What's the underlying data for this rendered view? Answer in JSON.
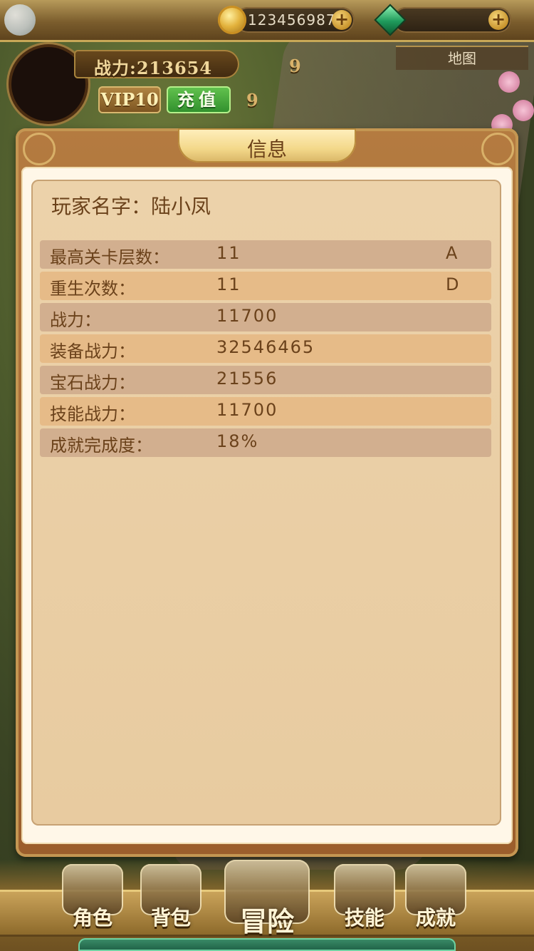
{
  "top_bar": {
    "gold_value": "123456987",
    "gem_value": ""
  },
  "header": {
    "power_label": "战力:213654",
    "badge_top": "9",
    "badge_bottom": "9",
    "vip_label": "VIP10",
    "recharge_label": "充值",
    "map_label": "地图"
  },
  "panel": {
    "title": "信息",
    "player_name": "玩家名字：陆小凤",
    "rows": [
      {
        "label": "最高关卡层数：",
        "value": "11",
        "extra": "A"
      },
      {
        "label": "重生次数：",
        "value": "11",
        "extra": "D"
      },
      {
        "label": "战力：",
        "value": "11700",
        "extra": ""
      },
      {
        "label": "装备战力：",
        "value": "32546465",
        "extra": ""
      },
      {
        "label": "宝石战力：",
        "value": "21556",
        "extra": ""
      },
      {
        "label": "技能战力：",
        "value": "11700",
        "extra": ""
      },
      {
        "label": "成就完成度：",
        "value": "18%",
        "extra": ""
      }
    ]
  },
  "bottom_nav": {
    "items": [
      {
        "label": "角色",
        "icon": "helmet-icon"
      },
      {
        "label": "背包",
        "icon": "chest-icon"
      },
      {
        "label": "冒险",
        "icon": "crossed-swords-icon"
      },
      {
        "label": "技能",
        "icon": "spellbook-icon"
      },
      {
        "label": "成就",
        "icon": "scroll-icon"
      }
    ]
  },
  "colors": {
    "panel_text": "#6b421b",
    "row_dark": "#d2af8f",
    "row_light": "#e6bb88",
    "panel_bg": "#e8cba0",
    "recharge_green": "#2f8e2c"
  }
}
